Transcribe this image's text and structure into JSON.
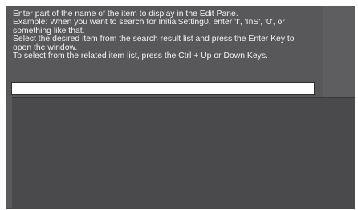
{
  "help": {
    "lines": [
      "Enter part of the name of the item to display in the Edit Pane.",
      "Example: When you want to search for InitialSetting0, enter 'I', 'InS', '0', or something like that.",
      "Select the desired item from the search result list and press the Enter Key to open the window.",
      "To select from the related item list, press the Ctrl + Up or Down Keys."
    ]
  },
  "search": {
    "value": ""
  },
  "results": {
    "items": []
  },
  "colors": {
    "panel_background": "#58585b",
    "list_background": "#4a4a4d",
    "side_panel": "#5e5e61",
    "help_text": "#f2f2f2"
  }
}
